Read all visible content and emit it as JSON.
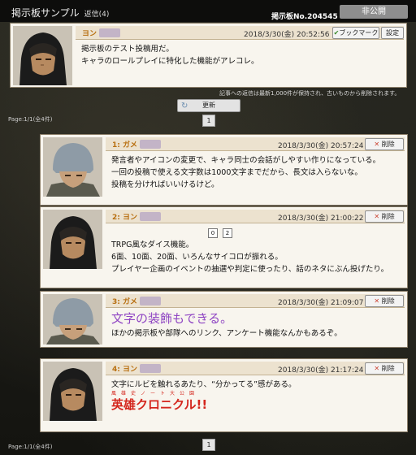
{
  "header": {
    "title": "掲示板サンプル",
    "reply_count": "返信(4)",
    "board_no": "掲示板No.204545",
    "visibility": "非公開"
  },
  "main_post": {
    "name": "ヨン",
    "date": "2018/3/30(金) 20:52:56",
    "bookmark_label": "ブックマーク",
    "settings_label": "設定",
    "lines": [
      "掲示板のテスト投稿用だ。",
      "キャラのロールプレイに特化した機能がアレコレ。"
    ]
  },
  "notice": "記事への返信は最新1,000件が保持され、古いものから削除されます。",
  "update_label": "更新",
  "pagination": {
    "info": "Page:1/1(全4件)",
    "page": "1"
  },
  "delete_label": "削除",
  "replies": [
    {
      "prefix": "1:",
      "name": "ガメ",
      "date": "2018/3/30(金) 20:57:24",
      "lines": [
        "発言者やアイコンの変更で、キャラ同士の会話がしやすい作りになっている。",
        "一回の投稿で使える文字数は1000文字までだから、長文は入らないな。",
        "投稿を分ければいいけるけど。"
      ]
    },
    {
      "prefix": "2:",
      "name": "ヨン",
      "date": "2018/3/30(金) 21:00:22",
      "dice": [
        "0",
        "2"
      ],
      "lines": [
        "TRPG風なダイス機能。",
        "6面、10面、20面、いろんなサイコロが振れる。",
        "プレイヤー企画のイベントの抽選や判定に使ったり、話のネタにぶん投げたり。"
      ]
    },
    {
      "prefix": "3:",
      "name": "ガメ",
      "date": "2018/3/30(金) 21:09:07",
      "decorated": "文字の装飾もできる。",
      "lines": [
        "ほかの掲示板や部隊へのリンク、アンケート機能なんかもあるぞ。"
      ]
    },
    {
      "prefix": "4:",
      "name": "ヨン",
      "date": "2018/3/30(金) 21:17:24",
      "lines": [
        "文字にルビを触れるあたり、“分かってる”感がある。"
      ],
      "ruby": "風雄史ノート大公園",
      "hero": "英雄クロニクル!!"
    }
  ],
  "colors": {
    "accent": "#b86f10",
    "header_bg": "#ece2cf",
    "decorated_text": "#8f45c3",
    "hero_text": "#d4261d"
  }
}
